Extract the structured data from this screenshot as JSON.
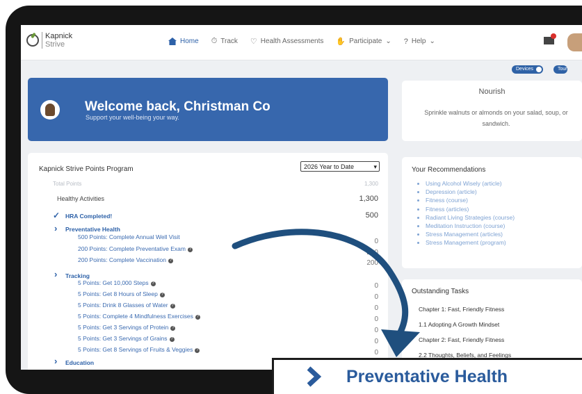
{
  "app": {
    "logo_line1": "Kapnick",
    "logo_line2": "Strive"
  },
  "nav": {
    "items": [
      {
        "label": "Home",
        "icon": "home-icon",
        "active": true
      },
      {
        "label": "Track",
        "icon": "stopwatch-icon"
      },
      {
        "label": "Health Assessments",
        "icon": "badge-icon"
      },
      {
        "label": "Participate",
        "icon": "hand-icon",
        "dropdown": true
      },
      {
        "label": "Help",
        "icon": "question-icon",
        "dropdown": true
      }
    ],
    "mail_icon": "mail-icon"
  },
  "pills": {
    "devices": "Devices",
    "tour": "Tour"
  },
  "welcome": {
    "title": "Welcome back, Christman Co",
    "subtitle": "Support your well-being your way."
  },
  "nourish": {
    "title": "Nourish",
    "body": "Sprinkle walnuts or almonds on your salad, soup, or sandwich."
  },
  "points": {
    "title": "Kapnick Strive Points Program",
    "period": "2026 Year to Date",
    "total_label": "Total Points",
    "total_value": "1,300",
    "healthy_label": "Healthy Activities",
    "healthy_value": "1,300",
    "hra_label": "HRA Completed!",
    "hra_value": "500",
    "preventative": {
      "label": "Preventative Health",
      "items": [
        {
          "label": "500 Points: Complete Annual Well Visit",
          "value": "0",
          "info": false
        },
        {
          "label": "200 Points: Complete Preventative Exam",
          "value": "200",
          "info": true
        },
        {
          "label": "200 Points: Complete Vaccination",
          "value": "200",
          "info": true
        }
      ]
    },
    "tracking": {
      "label": "Tracking",
      "items": [
        {
          "label": "5 Points: Get 10,000 Steps",
          "value": "0"
        },
        {
          "label": "5 Points: Get 8 Hours of Sleep",
          "value": "0"
        },
        {
          "label": "5 Points: Drink 8 Glasses of Water",
          "value": "0"
        },
        {
          "label": "5 Points: Complete 4 Mindfulness Exercises",
          "value": "0"
        },
        {
          "label": "5 Points: Get 3 Servings of Protein",
          "value": "0"
        },
        {
          "label": "5 Points: Get 3 Servings of Grains",
          "value": "0"
        },
        {
          "label": "5 Points: Get 8 Servings of Fruits & Veggies",
          "value": "0"
        }
      ]
    },
    "education": {
      "label": "Education"
    }
  },
  "recommendations": {
    "title": "Your Recommendations",
    "items": [
      "Using Alcohol Wisely (article)",
      "Depression (article)",
      "Fitness (course)",
      "Fitness (articles)",
      "Radiant Living Strategies (course)",
      "Meditation Instruction (course)",
      "Stress Management (articles)",
      "Stress Management (program)"
    ]
  },
  "tasks": {
    "title": "Outstanding Tasks",
    "items": [
      "Chapter 1: Fast, Friendly Fitness",
      "1.1 Adopting A Growth Mindset",
      "Chapter 2: Fast, Friendly Fitness",
      "2.2 Thoughts, Beliefs, and Feelings"
    ]
  },
  "callout": {
    "text": "Preventative Health",
    "icon": "chevron-right-icon"
  },
  "colors": {
    "brand": "#3767ad",
    "accent": "#2d61a8",
    "callout_text": "#2a5b9c",
    "arrow": "#1f4f7e"
  }
}
